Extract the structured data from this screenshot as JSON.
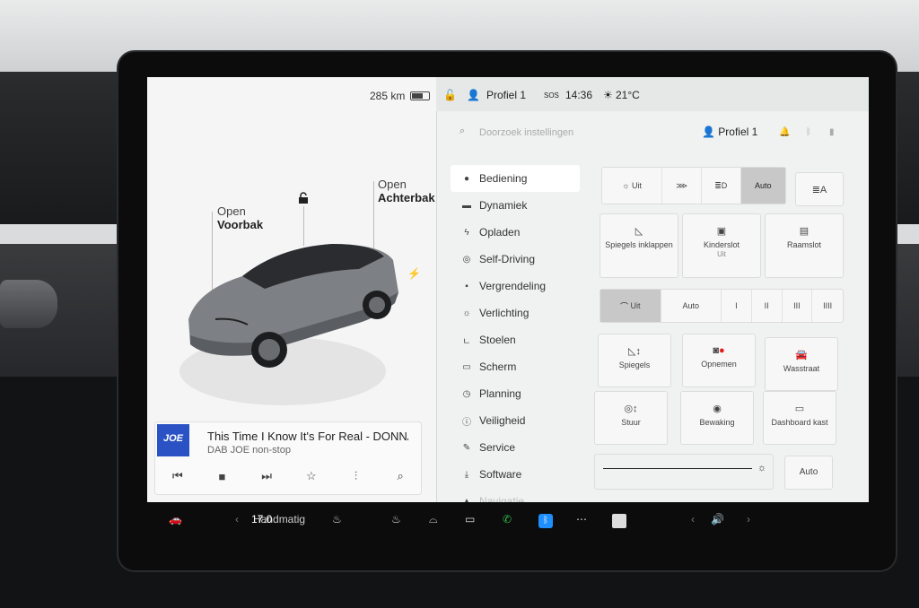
{
  "status": {
    "range": "285 km",
    "profile": "Profiel 1",
    "sos": "SOS",
    "time": "14:36",
    "temperature": "21°C"
  },
  "car": {
    "frunk_label": "Open",
    "frunk_value": "Voorbak",
    "trunk_label": "Open",
    "trunk_value": "Achterbak"
  },
  "media": {
    "logo": "JOE",
    "title": "This Time I Know It's For Real - DONNA",
    "station": "DAB JOE non-stop"
  },
  "settings": {
    "search_placeholder": "Doorzoek instellingen",
    "profile": "Profiel 1",
    "nav": [
      {
        "label": "Bediening",
        "icon": "toggle-icon"
      },
      {
        "label": "Dynamiek",
        "icon": "car-icon"
      },
      {
        "label": "Opladen",
        "icon": "bolt-icon"
      },
      {
        "label": "Self-Driving",
        "icon": "steering-icon"
      },
      {
        "label": "Vergrendeling",
        "icon": "lock-icon"
      },
      {
        "label": "Verlichting",
        "icon": "sun-icon"
      },
      {
        "label": "Stoelen",
        "icon": "seat-icon"
      },
      {
        "label": "Scherm",
        "icon": "screen-icon"
      },
      {
        "label": "Planning",
        "icon": "clock-icon"
      },
      {
        "label": "Veiligheid",
        "icon": "info-icon"
      },
      {
        "label": "Service",
        "icon": "wrench-icon"
      },
      {
        "label": "Software",
        "icon": "download-icon"
      },
      {
        "label": "Navigatie",
        "icon": "nav-icon"
      }
    ],
    "lights": {
      "off": "Uit",
      "auto": "Auto",
      "selected": "Auto"
    },
    "buttons": {
      "mirrors_fold": "Spiegels inklappen",
      "child_lock": "Kinderslot",
      "child_lock_state": "Uit",
      "window_lock": "Raamslot",
      "mirrors": "Spiegels",
      "record": "Opnemen",
      "car_wash": "Wasstraat",
      "steering": "Stuur",
      "sentry": "Bewaking",
      "glovebox": "Dashboard kast",
      "brightness_auto": "Auto"
    },
    "wipers": {
      "options": [
        "Uit",
        "Auto",
        "I",
        "II",
        "III",
        "IIII"
      ],
      "selected": "Uit"
    }
  },
  "taskbar": {
    "climate_mode": "Handmatig",
    "climate_temp": "17.0"
  },
  "colors": {
    "accent_blue": "#1f8fff",
    "phone_green": "#2fbf4a",
    "media_logo_blue": "#2a52c4",
    "selected_gray": "#c8c8c8"
  }
}
